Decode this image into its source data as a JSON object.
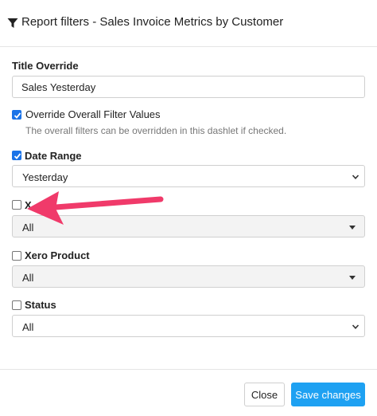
{
  "header": {
    "title": "Report filters - Sales Invoice Metrics by Customer",
    "icon": "filter-icon"
  },
  "title_override": {
    "label": "Title Override",
    "value": "Sales Yesterday"
  },
  "override_filters": {
    "label": "Override Overall Filter Values",
    "checked": true,
    "help": "The overall filters can be overridden in this dashlet if checked."
  },
  "date_range": {
    "label": "Date Range",
    "checked": true,
    "selected": "Yesterday"
  },
  "x_filter": {
    "label": "X",
    "checked": false,
    "selected": "All"
  },
  "xero_product": {
    "label": "Xero Product",
    "checked": false,
    "selected": "All"
  },
  "status": {
    "label": "Status",
    "checked": false,
    "selected": "All"
  },
  "footer": {
    "close_label": "Close",
    "save_label": "Save changes"
  },
  "colors": {
    "accent": "#1ea1f2",
    "checkbox": "#1a73e8",
    "annotation_arrow": "#f03a6a"
  }
}
